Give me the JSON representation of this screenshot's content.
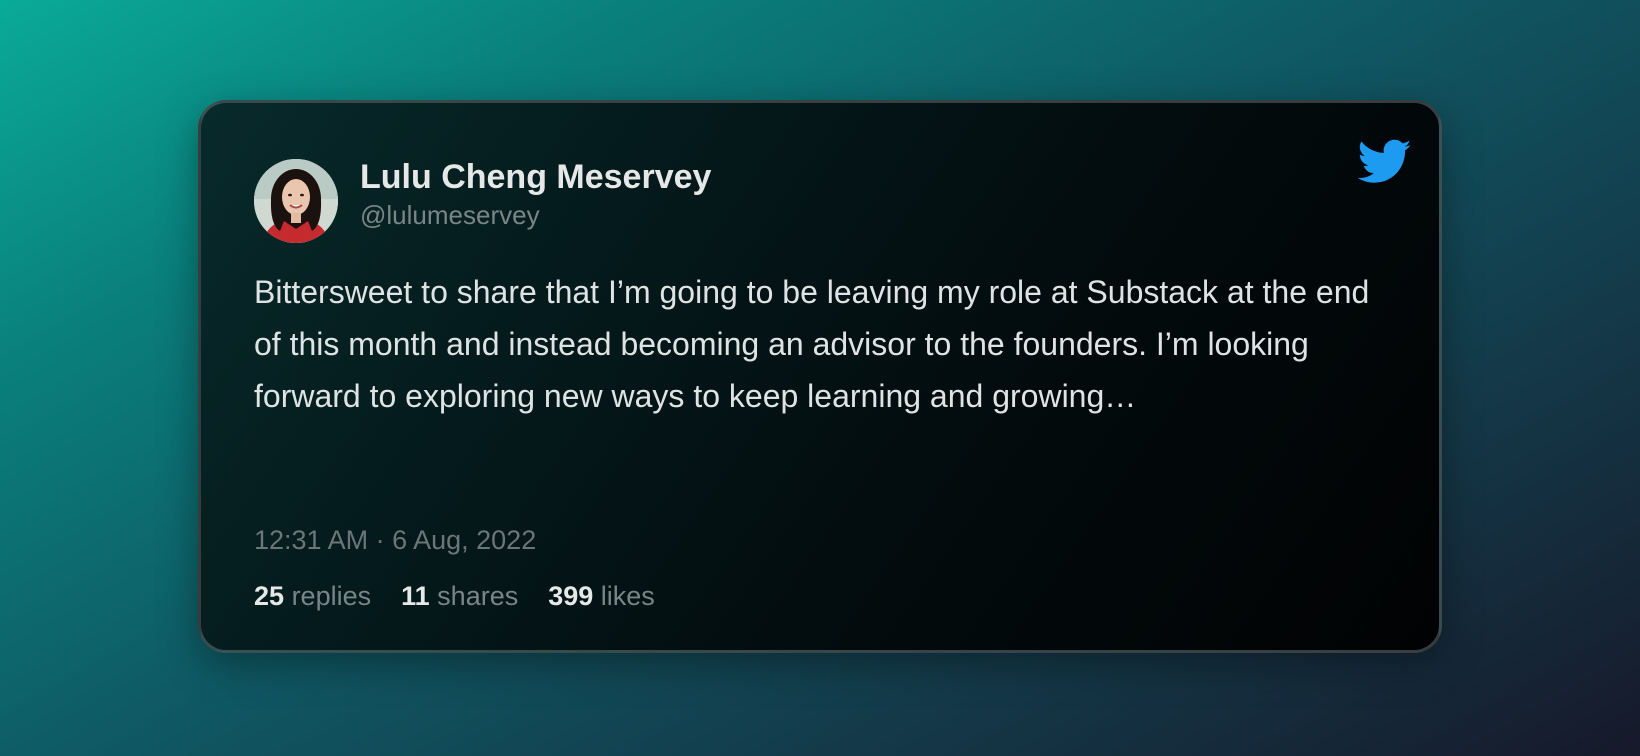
{
  "author": {
    "name": "Lulu Cheng Meservey",
    "handle": "@lulumeservey",
    "avatar_icon": "profile-photo"
  },
  "brand": {
    "icon": "twitter-bird-icon",
    "color": "#1d9bf0"
  },
  "tweet": {
    "text": "Bittersweet to share that I’m going to be leaving my role at Substack at the end of this month and instead becoming an advisor to the founders. I’m looking forward to exploring new ways to keep learning and growing…",
    "timestamp": "12:31 AM · 6 Aug, 2022"
  },
  "stats": {
    "replies": {
      "count": "25",
      "label": "replies"
    },
    "shares": {
      "count": "11",
      "label": "shares"
    },
    "likes": {
      "count": "399",
      "label": "likes"
    }
  }
}
